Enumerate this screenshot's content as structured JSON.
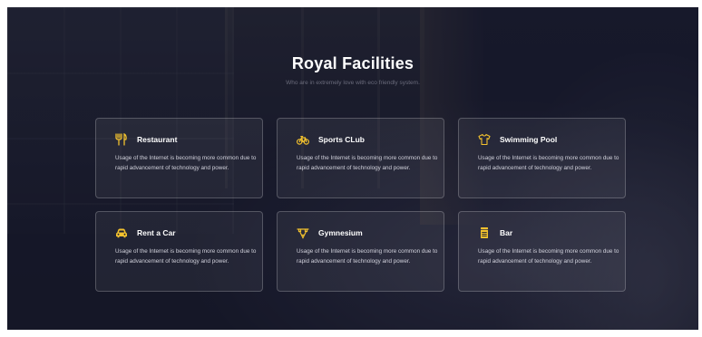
{
  "section": {
    "title": "Royal Facilities",
    "subtitle": "Who are in extremely love with eco friendly system."
  },
  "colors": {
    "accent": "#f2c12e",
    "background": "#1c1e31"
  },
  "facilities": [
    {
      "title": "Restaurant",
      "icon": "restaurant-icon",
      "text": "Usage of the Internet is becoming more common due to rapid advancement of technology and power."
    },
    {
      "title": "Sports CLub",
      "icon": "bicycle-icon",
      "text": "Usage of the Internet is becoming more common due to rapid advancement of technology and power."
    },
    {
      "title": "Swimming Pool",
      "icon": "tshirt-icon",
      "text": "Usage of the Internet is becoming more common due to rapid advancement of technology and power."
    },
    {
      "title": "Rent a Car",
      "icon": "car-icon",
      "text": "Usage of the Internet is becoming more common due to rapid advancement of technology and power."
    },
    {
      "title": "Gymnesium",
      "icon": "dumbbell-icon",
      "text": "Usage of the Internet is becoming more common due to rapid advancement of technology and power."
    },
    {
      "title": "Bar",
      "icon": "bar-icon",
      "text": "Usage of the Internet is becoming more common due to rapid advancement of technology and power."
    }
  ]
}
